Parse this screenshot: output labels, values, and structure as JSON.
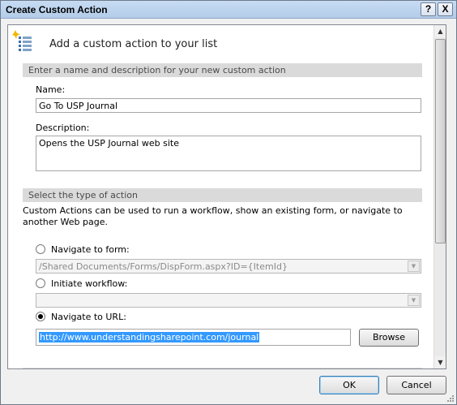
{
  "window": {
    "title": "Create Custom Action",
    "help_button": "?",
    "close_button": "X"
  },
  "header": {
    "icon": "custom-action-list-icon",
    "title": "Add a custom action to your list"
  },
  "section_name": {
    "heading": "Enter a name and description for your new custom action",
    "name_label": "Name:",
    "name_value": "Go To USP Journal",
    "description_label": "Description:",
    "description_value": "Opens the USP Journal web site"
  },
  "section_action": {
    "heading": "Select the type of action",
    "description": "Custom Actions can be used to run a workflow, show an existing form, or navigate to another Web page.",
    "options": [
      {
        "label": "Navigate to form:",
        "selected": false,
        "value": "/Shared Documents/Forms/DispForm.aspx?ID={ItemId}"
      },
      {
        "label": "Initiate workflow:",
        "selected": false,
        "value": ""
      },
      {
        "label": "Navigate to URL:",
        "selected": true,
        "value": "http://www.understandingsharepoint.com/journal"
      }
    ],
    "browse_label": "Browse"
  },
  "footer": {
    "ok_label": "OK",
    "cancel_label": "Cancel"
  },
  "colors": {
    "titlebar": "#b3cce9",
    "section_header": "#dadada",
    "selection": "#3399ff"
  }
}
